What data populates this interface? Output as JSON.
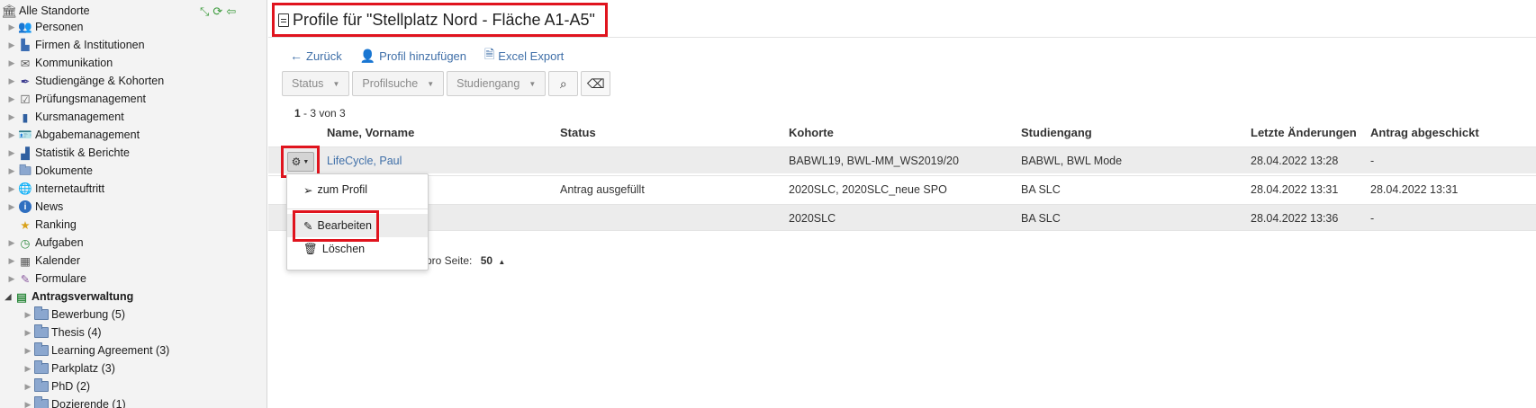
{
  "sidebar": {
    "root_label": "Alle Standorte",
    "root_actions": [
      "collapse-icon",
      "refresh-icon",
      "back-arrow-icon"
    ],
    "items": [
      {
        "label": "Personen",
        "icon": "people-icon"
      },
      {
        "label": "Firmen & Institutionen",
        "icon": "factory-icon"
      },
      {
        "label": "Kommunikation",
        "icon": "envelope-icon"
      },
      {
        "label": "Studiengänge & Kohorten",
        "icon": "feather-icon"
      },
      {
        "label": "Prüfungsmanagement",
        "icon": "checklist-icon"
      },
      {
        "label": "Kursmanagement",
        "icon": "book-icon"
      },
      {
        "label": "Abgabemanagement",
        "icon": "id-card-icon"
      },
      {
        "label": "Statistik & Berichte",
        "icon": "bar-chart-icon"
      },
      {
        "label": "Dokumente",
        "icon": "folder-icon"
      },
      {
        "label": "Internetauftritt",
        "icon": "globe-icon"
      },
      {
        "label": "News",
        "icon": "info-icon"
      },
      {
        "label": "Ranking",
        "icon": "award-icon"
      },
      {
        "label": "Aufgaben",
        "icon": "clock-icon"
      },
      {
        "label": "Kalender",
        "icon": "calendar-icon"
      },
      {
        "label": "Formulare",
        "icon": "form-icon"
      },
      {
        "label": "Antragsverwaltung",
        "icon": "spreadsheet-icon"
      }
    ],
    "subitems": [
      {
        "label": "Bewerbung (5)"
      },
      {
        "label": "Thesis (4)"
      },
      {
        "label": "Learning Agreement (3)"
      },
      {
        "label": "Parkplatz (3)"
      },
      {
        "label": "PhD (2)"
      },
      {
        "label": "Dozierende (1)"
      }
    ]
  },
  "page": {
    "title": "Profile für \"Stellplatz Nord - Fläche A1-A5\""
  },
  "toolbar": {
    "back_label": "Zurück",
    "add_label": "Profil hinzufügen",
    "export_label": "Excel Export"
  },
  "filters": {
    "status": "Status",
    "profilsuche": "Profilsuche",
    "studiengang": "Studiengang"
  },
  "pager": {
    "start": "1",
    "rest": " - 3 von 3",
    "per_page_label": "pro Seite:",
    "per_page_value": "50"
  },
  "table": {
    "headers": {
      "name": "Name, Vorname",
      "status": "Status",
      "kohorte": "Kohorte",
      "studiengang": "Studiengang",
      "changed": "Letzte Änderungen",
      "submitted": "Antrag abgeschickt"
    },
    "rows": [
      {
        "name": "LifeCycle, Paul",
        "status": "",
        "kohorte": "BABWL19, BWL-MM_WS2019/20",
        "studiengang": "BABWL, BWL Mode",
        "changed": "28.04.2022 13:28",
        "submitted": "-"
      },
      {
        "name": "",
        "status": "Antrag ausgefüllt",
        "kohorte": "2020SLC, 2020SLC_neue SPO",
        "studiengang": "BA SLC",
        "changed": "28.04.2022 13:31",
        "submitted": "28.04.2022 13:31"
      },
      {
        "name": "",
        "status": "",
        "kohorte": "2020SLC",
        "studiengang": "BA SLC",
        "changed": "28.04.2022 13:36",
        "submitted": "-"
      }
    ]
  },
  "row_menu": {
    "to_profile": "zum Profil",
    "edit": "Bearbeiten",
    "delete": "Löschen"
  },
  "colors": {
    "highlight": "#e0141e",
    "link": "#3f6fa8"
  }
}
